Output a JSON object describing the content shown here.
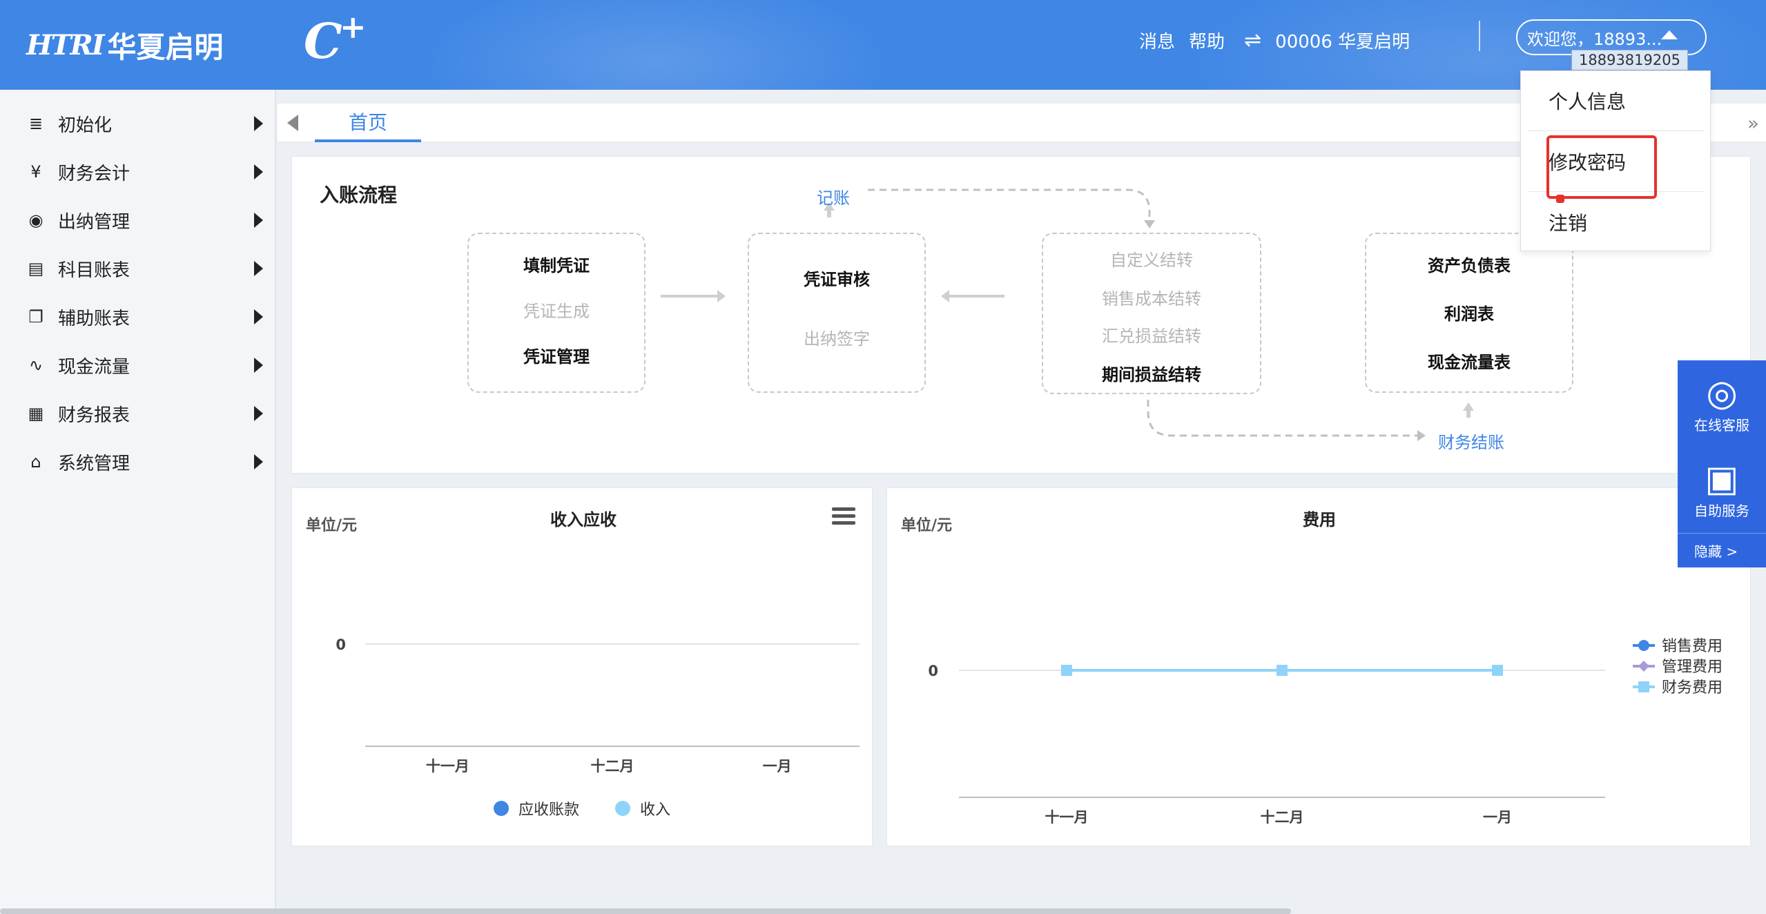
{
  "header": {
    "logo_mark": "HTRI",
    "logo_name": "华夏启明",
    "cplus_c": "C",
    "cplus_plus": "+",
    "messages": "消息",
    "help": "帮助",
    "swap_icon": "⇌",
    "org": "00006 华夏启明",
    "welcome": "欢迎您，18893...",
    "tooltip": "18893819205"
  },
  "sidebar": {
    "items": [
      {
        "label": "初始化",
        "icon": "database-icon",
        "glyph": "≣"
      },
      {
        "label": "财务会计",
        "icon": "yen-icon",
        "glyph": "¥"
      },
      {
        "label": "出纳管理",
        "icon": "cashier-icon",
        "glyph": "◉"
      },
      {
        "label": "科目账表",
        "icon": "document-icon",
        "glyph": "▤"
      },
      {
        "label": "辅助账表",
        "icon": "copy-icon",
        "glyph": "❐"
      },
      {
        "label": "现金流量",
        "icon": "flow-icon",
        "glyph": "∿"
      },
      {
        "label": "财务报表",
        "icon": "calculator-icon",
        "glyph": "▦"
      },
      {
        "label": "系统管理",
        "icon": "home-icon",
        "glyph": "⌂"
      }
    ]
  },
  "tabs": {
    "home": "首页",
    "next_glyph": "»"
  },
  "flow": {
    "title": "入账流程",
    "record": "记账",
    "close": "财务结账",
    "box1": [
      "填制凭证",
      "凭证生成",
      "凭证管理"
    ],
    "box2": [
      "凭证审核",
      "出纳签字"
    ],
    "box3": [
      "自定义结转",
      "销售成本结转",
      "汇兑损益结转",
      "期间损益结转"
    ],
    "box4": [
      "资产负债表",
      "利润表",
      "现金流量表"
    ]
  },
  "dropdown": {
    "items": [
      "个人信息",
      "修改密码",
      "注销"
    ]
  },
  "float": {
    "online_glyph": "◎",
    "online": "在线客服",
    "self_glyph": "▣",
    "self": "自助服务",
    "hide": "隐藏  >"
  },
  "chart_data": [
    {
      "type": "line",
      "title": "收入应收",
      "unit_label": "单位/元",
      "categories": [
        "十一月",
        "十二月",
        "一月"
      ],
      "yticks": [
        "0"
      ],
      "series": [
        {
          "name": "应收账款",
          "values": [
            0,
            0,
            0
          ],
          "color": "#3f86e5"
        },
        {
          "name": "收入",
          "values": [
            0,
            0,
            0
          ],
          "color": "#8fd3f8"
        }
      ]
    },
    {
      "type": "line",
      "title": "费用",
      "unit_label": "单位/元",
      "categories": [
        "十一月",
        "十二月",
        "一月"
      ],
      "yticks": [
        "0"
      ],
      "series": [
        {
          "name": "销售费用",
          "values": [
            0,
            0,
            0
          ],
          "color": "#3f86e5"
        },
        {
          "name": "管理费用",
          "values": [
            0,
            0,
            0
          ],
          "color": "#a99ad6"
        },
        {
          "name": "财务费用",
          "values": [
            0,
            0,
            0
          ],
          "color": "#8fd3f8"
        }
      ]
    }
  ]
}
